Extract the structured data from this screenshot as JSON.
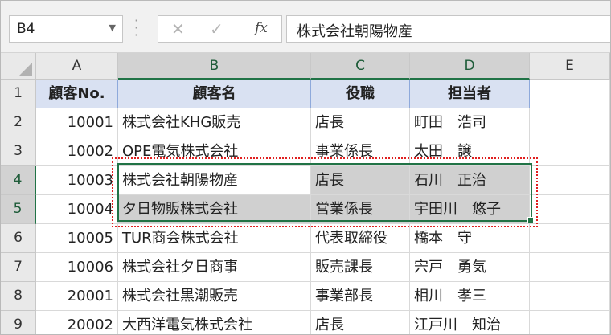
{
  "formula_bar": {
    "name_box": "B4",
    "cancel_icon": "✕",
    "enter_icon": "✓",
    "fx_label": "fx",
    "formula": "株式会社朝陽物産"
  },
  "columns": [
    "A",
    "B",
    "C",
    "D",
    "E"
  ],
  "rows": [
    "1",
    "2",
    "3",
    "4",
    "5",
    "6",
    "7",
    "8",
    "9"
  ],
  "table": {
    "headers": [
      "顧客No.",
      "顧客名",
      "役職",
      "担当者"
    ],
    "rows": [
      [
        "10001",
        "株式会社KHG販売",
        "店長",
        "町田　浩司"
      ],
      [
        "10002",
        "OPE電気株式会社",
        "事業係長",
        "太田　譲"
      ],
      [
        "10003",
        "株式会社朝陽物産",
        "店長",
        "石川　正治"
      ],
      [
        "10004",
        "夕日物販株式会社",
        "営業係長",
        "宇田川　悠子"
      ],
      [
        "10005",
        "TUR商会株式会社",
        "代表取締役",
        "橋本　守"
      ],
      [
        "10006",
        "株式会社夕日商事",
        "販売課長",
        "宍戸　勇気"
      ],
      [
        "20001",
        "株式会社黒潮販売",
        "事業部長",
        "相川　孝三"
      ],
      [
        "20002",
        "大西洋電気株式会社",
        "店長",
        "江戸川　知治"
      ]
    ]
  },
  "selection": {
    "active_cell": "B4",
    "range": "B4:D5",
    "highlight_color": "#217346",
    "marquee_color": "#e02020"
  }
}
